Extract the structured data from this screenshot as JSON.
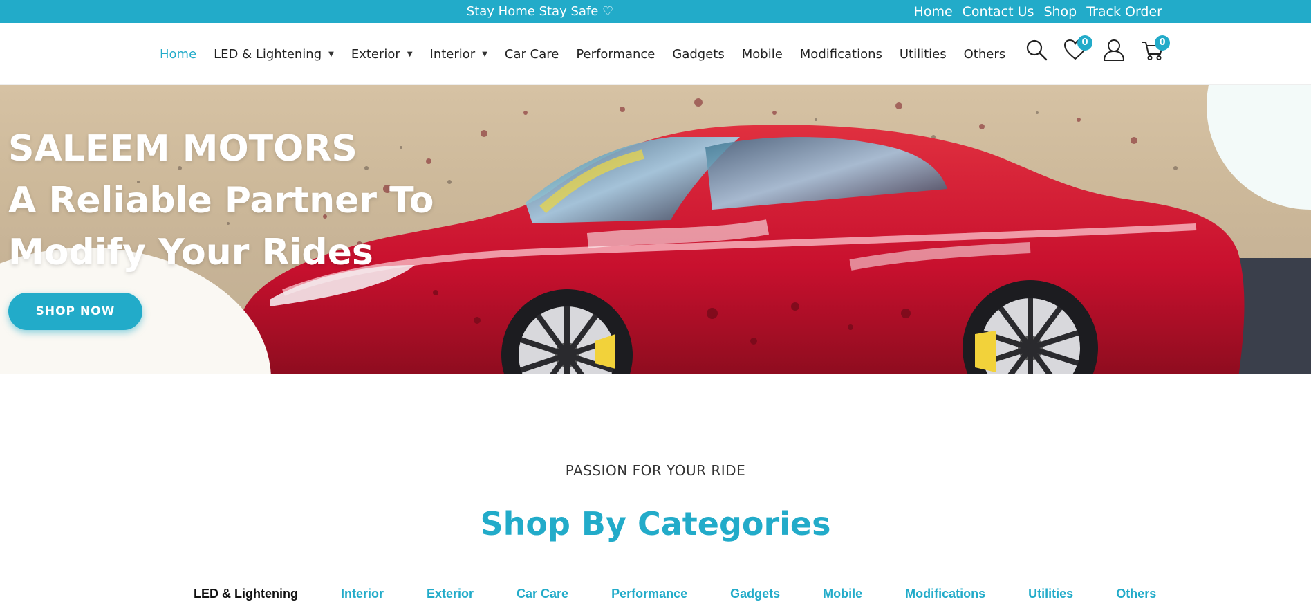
{
  "topbar": {
    "promo": "Stay Home Stay Safe ♡",
    "links": [
      "Home",
      "Contact Us",
      "Shop",
      "Track Order"
    ]
  },
  "nav": {
    "items": [
      {
        "label": "Home",
        "active": true,
        "dropdown": false
      },
      {
        "label": "LED & Lightening",
        "active": false,
        "dropdown": true
      },
      {
        "label": "Exterior",
        "active": false,
        "dropdown": true
      },
      {
        "label": "Interior",
        "active": false,
        "dropdown": true
      },
      {
        "label": "Car Care",
        "active": false,
        "dropdown": false
      },
      {
        "label": "Performance",
        "active": false,
        "dropdown": false
      },
      {
        "label": "Gadgets",
        "active": false,
        "dropdown": false
      },
      {
        "label": "Mobile",
        "active": false,
        "dropdown": false
      },
      {
        "label": "Modifications",
        "active": false,
        "dropdown": false
      },
      {
        "label": "Utilities",
        "active": false,
        "dropdown": false
      },
      {
        "label": "Others",
        "active": false,
        "dropdown": false
      }
    ],
    "caret": "▼"
  },
  "header_icons": {
    "wishlist_count": "0",
    "cart_count": "0",
    "icon_names": [
      "search-icon",
      "heart-icon",
      "user-icon",
      "cart-icon"
    ]
  },
  "hero": {
    "line1": "SALEEM MOTORS",
    "line2": "A Reliable Partner To",
    "line3": "Modify Your Rides",
    "button": "SHOP NOW"
  },
  "categories": {
    "subheading": "PASSION FOR YOUR RIDE",
    "title": "Shop By Categories",
    "tabs": [
      {
        "label": "LED & Lightening",
        "active": true
      },
      {
        "label": "Interior",
        "active": false
      },
      {
        "label": "Exterior",
        "active": false
      },
      {
        "label": "Car Care",
        "active": false
      },
      {
        "label": "Performance",
        "active": false
      },
      {
        "label": "Gadgets",
        "active": false
      },
      {
        "label": "Mobile",
        "active": false
      },
      {
        "label": "Modifications",
        "active": false
      },
      {
        "label": "Utilities",
        "active": false
      },
      {
        "label": "Others",
        "active": false
      }
    ]
  },
  "colors": {
    "accent": "#22abc9",
    "car": "#c8102e"
  }
}
